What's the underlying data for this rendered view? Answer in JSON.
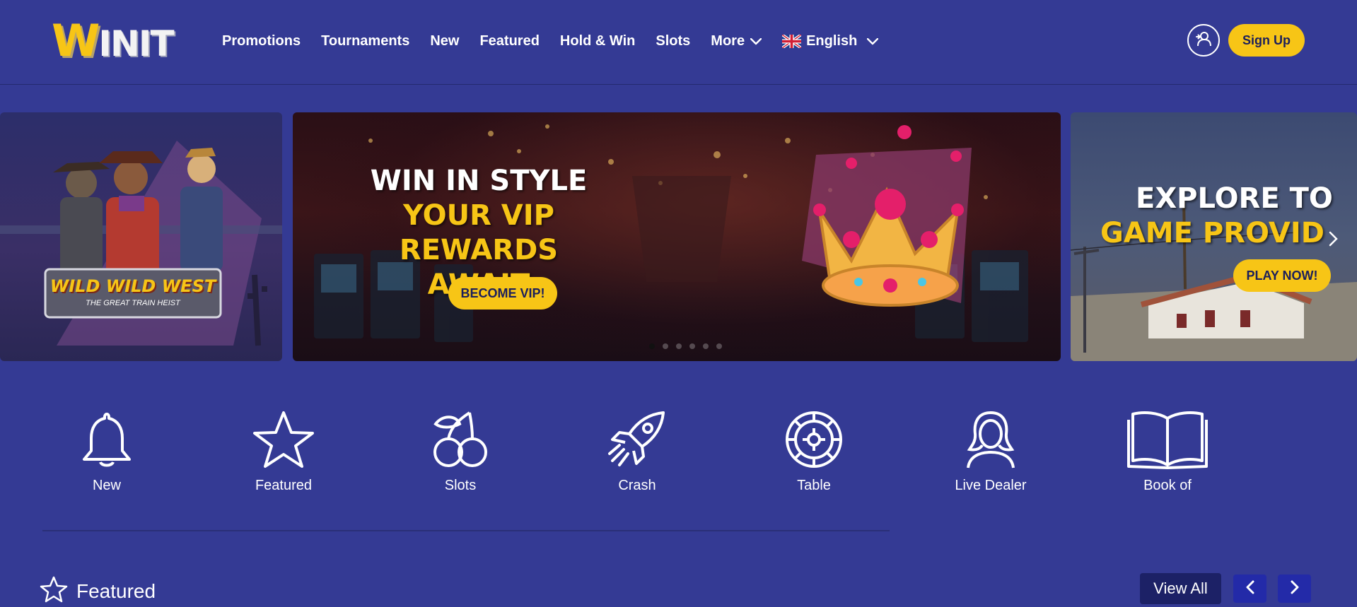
{
  "header": {
    "logo_first": "W",
    "logo_rest": "INIT",
    "nav": [
      {
        "label": "Promotions"
      },
      {
        "label": "Tournaments"
      },
      {
        "label": "New"
      },
      {
        "label": "Featured"
      },
      {
        "label": "Hold & Win"
      },
      {
        "label": "Slots"
      },
      {
        "label": "More"
      }
    ],
    "language": "English",
    "signup_label": "Sign Up"
  },
  "carousel": {
    "left_slide": {
      "logo_line1": "WILD WILD WEST",
      "logo_line2": "THE GREAT TRAIN HEIST"
    },
    "main_slide": {
      "line1": "WIN IN STYLE",
      "line2": "YOUR VIP REWARDS",
      "line3": "AWAIT",
      "button": "BECOME VIP!"
    },
    "right_slide": {
      "line1": "EXPLORE TO",
      "line2": "GAME PROVID",
      "button": "PLAY NOW!"
    },
    "active_dot": 1,
    "dot_count": 6
  },
  "categories": [
    {
      "label": "New",
      "icon": "bell-icon"
    },
    {
      "label": "Featured",
      "icon": "star-icon"
    },
    {
      "label": "Slots",
      "icon": "cherries-icon"
    },
    {
      "label": "Crash",
      "icon": "rocket-icon"
    },
    {
      "label": "Table",
      "icon": "roulette-icon"
    },
    {
      "label": "Live Dealer",
      "icon": "dealer-icon"
    },
    {
      "label": "Book of",
      "icon": "book-icon"
    }
  ],
  "featured": {
    "title": "Featured",
    "view_all": "View All"
  },
  "colors": {
    "background": "#343a94",
    "accent": "#f7c516",
    "dark_button": "#1c2166",
    "arrow_button": "#232aa8"
  }
}
